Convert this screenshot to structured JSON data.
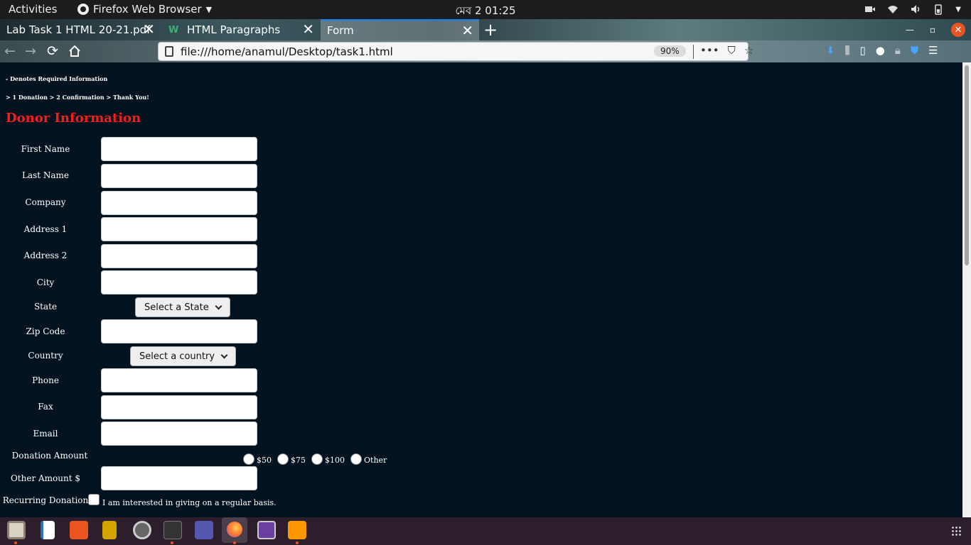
{
  "system": {
    "activities": "Activities",
    "app_name": "Firefox Web Browser",
    "clock": "মেব 2  01:25"
  },
  "browser": {
    "tabs": [
      {
        "label": "Lab Task 1 HTML 20-21.pdf"
      },
      {
        "label": "HTML Paragraphs"
      },
      {
        "label": "Form"
      }
    ],
    "url": "file:///home/anamul/Desktop/task1.html",
    "zoom": "90%"
  },
  "page": {
    "required_note": "- Denotes Required Information",
    "steps": "> 1 Donation > 2 Confirmation > Thank You!",
    "heading": "Donor Information",
    "labels": {
      "first_name": "First Name",
      "last_name": "Last Name",
      "company": "Company",
      "address1": "Address 1",
      "address2": "Address 2",
      "city": "City",
      "state": "State",
      "zip": "Zip Code",
      "country": "Country",
      "phone": "Phone",
      "fax": "Fax",
      "email": "Email",
      "donation_amount": "Donation Amount",
      "other_amount": "Other Amount $",
      "recurring": "Recurring Donation"
    },
    "state_select": "Select a State",
    "country_select": "Select a country",
    "amount_options": [
      "$50",
      "$75",
      "$100",
      "Other"
    ],
    "recurring_text": "I am interested in giving on a regular basis."
  },
  "colors": {
    "page_bg": "#02131f",
    "heading": "#ff1a1a",
    "dock_bg": "#2c1f2b",
    "accent": "#e95420"
  }
}
